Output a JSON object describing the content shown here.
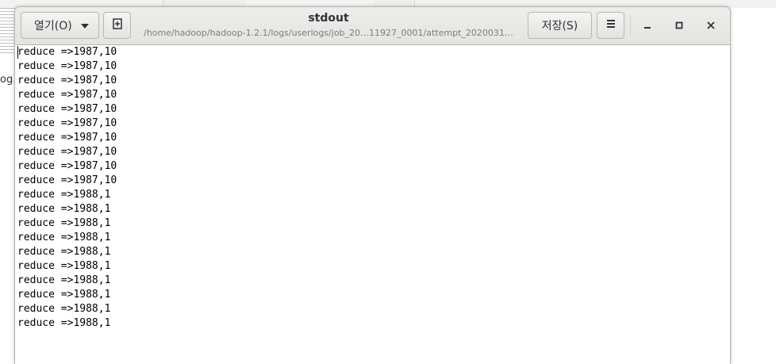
{
  "background": {
    "partial_text": "og."
  },
  "headerbar": {
    "open_label": "열기(O)",
    "title": "stdout",
    "subtitle": "/home/hadoop/hadoop-1.2.1/logs/userlogs/job_20…11927_0001/attempt_2020031…",
    "save_label": "저장(S)"
  },
  "editor": {
    "lines": [
      "reduce =>1987,10",
      "reduce =>1987,10",
      "reduce =>1987,10",
      "reduce =>1987,10",
      "reduce =>1987,10",
      "reduce =>1987,10",
      "reduce =>1987,10",
      "reduce =>1987,10",
      "reduce =>1987,10",
      "reduce =>1987,10",
      "reduce =>1988,1",
      "reduce =>1988,1",
      "reduce =>1988,1",
      "reduce =>1988,1",
      "reduce =>1988,1",
      "reduce =>1988,1",
      "reduce =>1988,1",
      "reduce =>1988,1",
      "reduce =>1988,1",
      "reduce =>1988,1"
    ]
  },
  "icons": {
    "open_dropdown": "chevron-down-icon",
    "new_tab": "new-document-icon",
    "menu": "hamburger-menu-icon",
    "minimize": "minimize-icon",
    "maximize": "maximize-icon",
    "close": "close-icon"
  }
}
